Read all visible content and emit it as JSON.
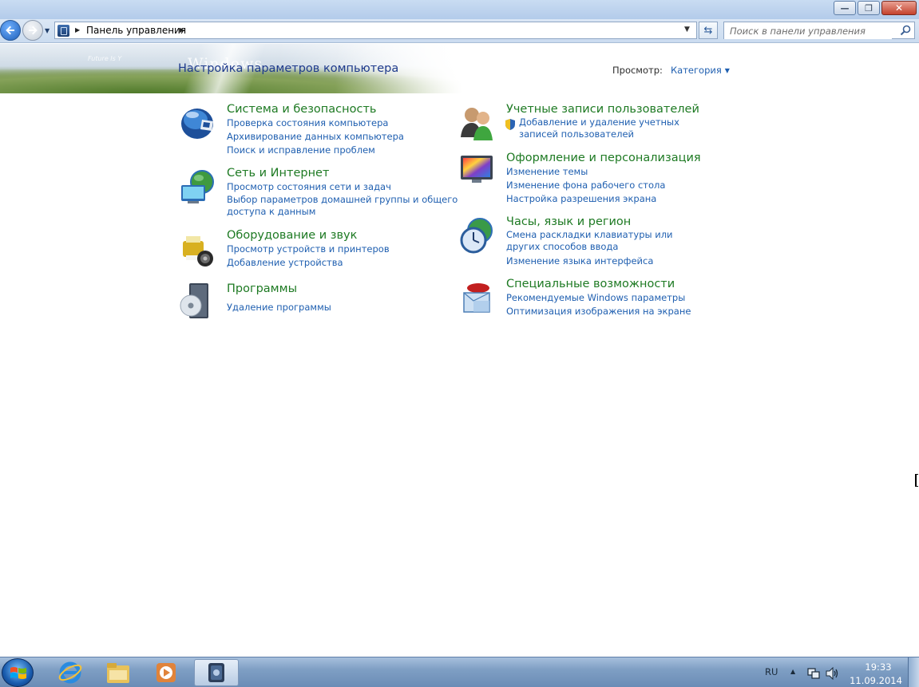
{
  "window": {
    "minimize_glyph": "—",
    "maximize_glyph": "❐",
    "close_glyph": "✕"
  },
  "address_bar": {
    "breadcrumb": "Панель управления",
    "search_placeholder": "Поиск в панели управления"
  },
  "header": {
    "title": "Настройка параметров компьютера",
    "banner_wordmark": "Windows",
    "banner_tagline": "Future Is Y",
    "view_label": "Просмотр:",
    "view_value": "Категория"
  },
  "categories_left": [
    {
      "icon": "shield-helmet-icon",
      "title": "Система и безопасность",
      "links": [
        "Проверка состояния компьютера",
        "Архивирование данных компьютера",
        "Поиск и исправление проблем"
      ]
    },
    {
      "icon": "network-globe-icon",
      "title": "Сеть и Интернет",
      "links": [
        "Просмотр состояния сети и задач",
        "Выбор параметров домашней группы и общего доступа к данным"
      ]
    },
    {
      "icon": "printer-speaker-icon",
      "title": "Оборудование и звук",
      "links": [
        "Просмотр устройств и принтеров",
        "Добавление устройства"
      ]
    },
    {
      "icon": "programs-disc-icon",
      "title": "Программы",
      "links": [
        "Удаление программы"
      ]
    }
  ],
  "categories_right": [
    {
      "icon": "users-icon",
      "title": "Учетные записи пользователей",
      "links": [
        "Добавление и удаление учетных записей пользователей"
      ]
    },
    {
      "icon": "appearance-palette-icon",
      "title": "Оформление и персонализация",
      "links": [
        "Изменение темы",
        "Изменение фона рабочего стола",
        "Настройка разрешения экрана"
      ]
    },
    {
      "icon": "clock-globe-icon",
      "title": "Часы, язык и регион",
      "links": [
        "Смена раскладки клавиатуры или других способов ввода",
        "Изменение языка интерфейса"
      ]
    },
    {
      "icon": "accessibility-icon",
      "title": "Специальные возможности",
      "links": [
        "Рекомендуемые Windows параметры",
        "Оптимизация изображения на экране"
      ]
    }
  ],
  "taskbar": {
    "language": "RU",
    "time": "19:33",
    "date": "11.09.2014"
  },
  "colors": {
    "category_title": "#1e7a23",
    "link": "#1f5fb0",
    "page_title": "#1e3a8c"
  }
}
